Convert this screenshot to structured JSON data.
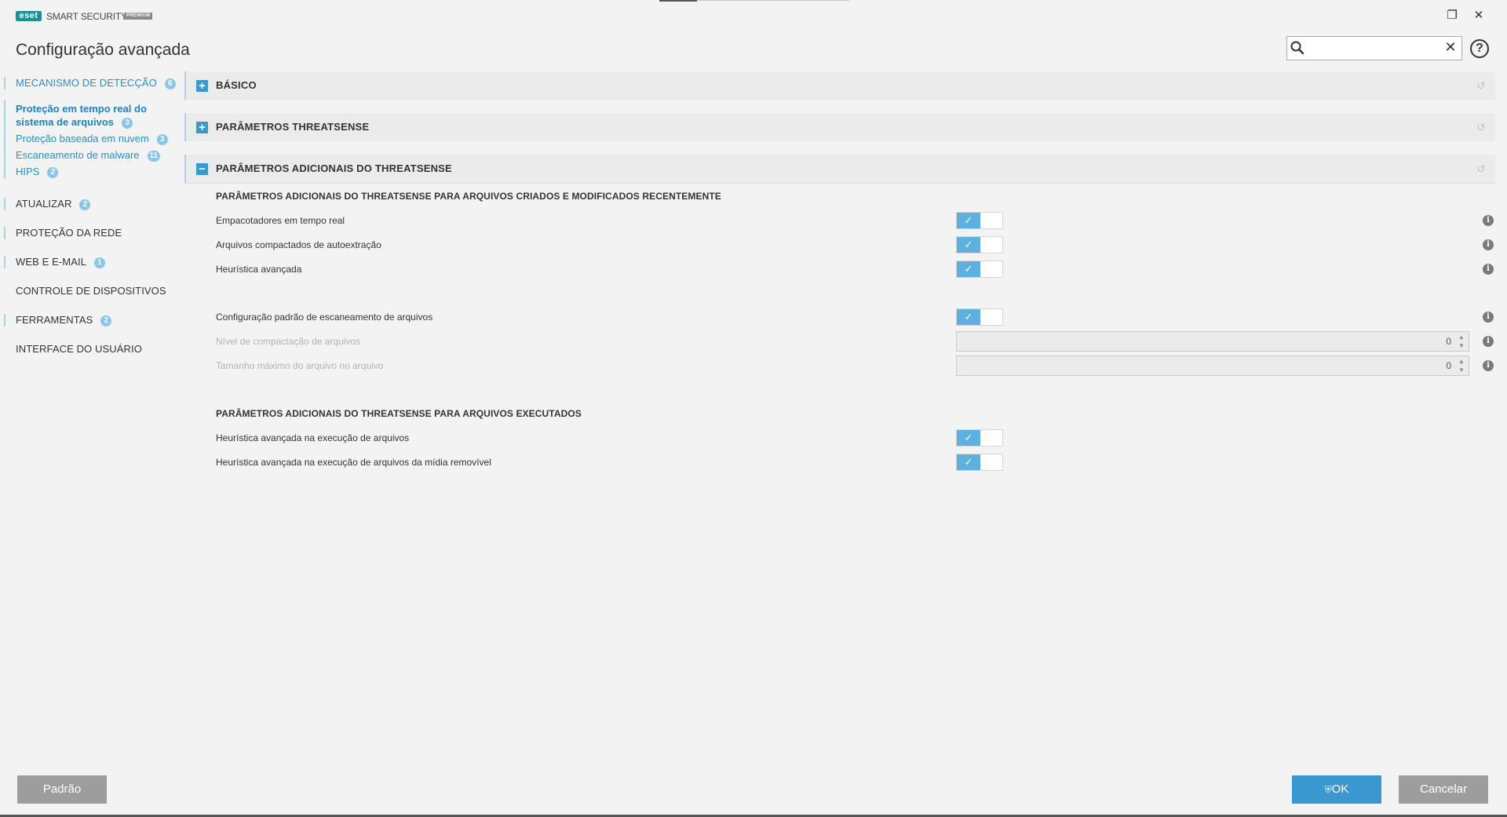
{
  "app": {
    "logo_text": "eset",
    "product_name": "SMART SECURITY",
    "product_tier": "PREMIUM",
    "window_title": "Configuração avançada"
  },
  "window_controls": {
    "restore_glyph": "❐",
    "close_glyph": "✕"
  },
  "search": {
    "value": "",
    "placeholder": "",
    "clear_glyph": "✕"
  },
  "help": {
    "glyph": "?"
  },
  "sidebar": {
    "items": [
      {
        "label": "MECANISMO DE DETECÇÃO",
        "badge": "6"
      },
      {
        "label": "Proteção em tempo real do",
        "label2": "sistema de arquivos",
        "badge": "3"
      },
      {
        "label": "Proteção baseada em nuvem",
        "badge": "3"
      },
      {
        "label": "Escaneamento de malware",
        "badge": "11"
      },
      {
        "label": "HIPS",
        "badge": "2"
      },
      {
        "label": "ATUALIZAR",
        "badge": "2"
      },
      {
        "label": "PROTEÇÃO DA REDE"
      },
      {
        "label": "WEB E E-MAIL",
        "badge": "1"
      },
      {
        "label": "CONTROLE DE DISPOSITIVOS"
      },
      {
        "label": "FERRAMENTAS",
        "badge": "2"
      },
      {
        "label": "INTERFACE DO USUÁRIO"
      }
    ]
  },
  "main": {
    "sections": [
      {
        "label": "BÁSICO",
        "icon": "+"
      },
      {
        "label": "PARÂMETROS THREATSENSE",
        "icon": "+"
      },
      {
        "label": "PARÂMETROS ADICIONAIS DO THREATSENSE",
        "icon": "−"
      }
    ],
    "revert_glyph": "↺",
    "group1_title": "PARÂMETROS ADICIONAIS DO THREATSENSE PARA ARQUIVOS CRIADOS E MODIFICADOS RECENTEMENTE",
    "group2_title": "PARÂMETROS ADICIONAIS DO THREATSENSE PARA ARQUIVOS EXECUTADOS",
    "options": [
      {
        "label": "Empacotadores em tempo real",
        "checked": true
      },
      {
        "label": "Arquivos compactados de autoextração",
        "checked": true
      },
      {
        "label": "Heurística avançada",
        "checked": true
      },
      {
        "label": "Configuração padrão de escaneamento de arquivos",
        "checked": true
      },
      {
        "label": "Nível de compactação de arquivos",
        "value": "0",
        "disabled": true
      },
      {
        "label": "Tamanho máximo do arquivo no arquivo",
        "value": "0",
        "disabled": true
      },
      {
        "label": "Heurística avançada na execução de arquivos",
        "checked": true
      },
      {
        "label": "Heurística avançada na execução de arquivos da mídia removível",
        "checked": true
      }
    ],
    "check_glyph": "✓",
    "info_glyph": "i"
  },
  "footer": {
    "default_label": "Padrão",
    "ok_label": "OK",
    "cancel_label": "Cancelar"
  },
  "colors": {
    "accent": "#3a97cf",
    "toggle_on": "#5db1e0",
    "badge": "#8ac6e9",
    "brand_teal": "#1a8f9e"
  }
}
